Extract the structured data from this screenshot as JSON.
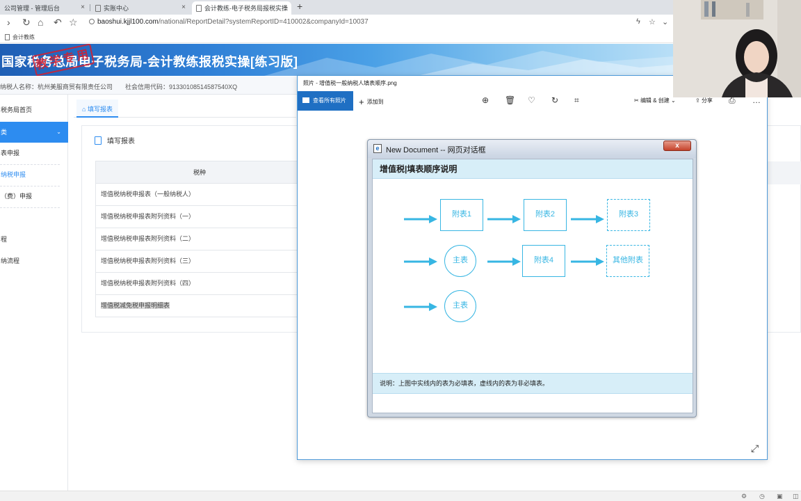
{
  "browser": {
    "tabs": [
      {
        "label": "公司管理 - 管理后台"
      },
      {
        "label": "实账中心"
      },
      {
        "label": "会计教练-电子税务局报税实操"
      }
    ],
    "new_tab_icon": "+",
    "url_domain": "baoshui.kjjl100.com",
    "url_path": "/national/ReportDetail?systemReportID=410002&companyId=10037",
    "bookmark": "会计教练"
  },
  "site": {
    "banner_title": "国家税务总局电子税务局-会计教练报税实操[练习版]",
    "stamp_text": "教学专用",
    "taxpayer_name": "纳税人名称：杭州美服商贸有限责任公司",
    "credit_code": "社会信用代码：91330108514587540XQ",
    "sidebar": [
      {
        "label": "税务局首页"
      },
      {
        "label": "类"
      },
      {
        "label": "表申报"
      },
      {
        "label": "纳税申报"
      },
      {
        "label": "（费）申报"
      },
      {
        "label": "程"
      },
      {
        "label": "纳流程"
      }
    ],
    "content_tab": "填写报表",
    "panel_title": "填写报表",
    "table_header": "税种",
    "rows": [
      "增值税纳税申报表（一般纳税人）",
      "增值税纳税申报表附列资料（一）",
      "增值税纳税申报表附列资料（二）",
      "增值税纳税申报表附列资料（三）",
      "增值税纳税申报表附列资料（四）",
      "增值税减免税申报明细表"
    ]
  },
  "viewer": {
    "title": "照片 - 增值税一般纳税人填表顺序.png",
    "see_all": "查看所有照片",
    "add_to": "添加到",
    "edit_create": "编辑 & 创建",
    "share": "分享",
    "icons": [
      "zoom-in-icon",
      "delete-icon",
      "favorite-icon",
      "rotate-icon",
      "crop-icon",
      "print-icon",
      "more-icon",
      "expand-icon"
    ]
  },
  "dialog": {
    "window_title": "New Document -- 网页对话框",
    "close_label": "x",
    "heading": "增值税|填表顺序说明",
    "nodes": {
      "row1": [
        "附表1",
        "附表2",
        "附表3"
      ],
      "row2": [
        "主表",
        "附表4",
        "其他附表"
      ],
      "row3": [
        "主表"
      ]
    },
    "note": "说明：上图中实线内的表为必填表，虚线内的表为非必填表。",
    "accent": "#37b6e3"
  },
  "colors": {
    "primary": "#2d8cf0",
    "banner": "#2f7fd6",
    "stamp": "#d81e2c",
    "viewer_accent": "#1f6fc3"
  }
}
